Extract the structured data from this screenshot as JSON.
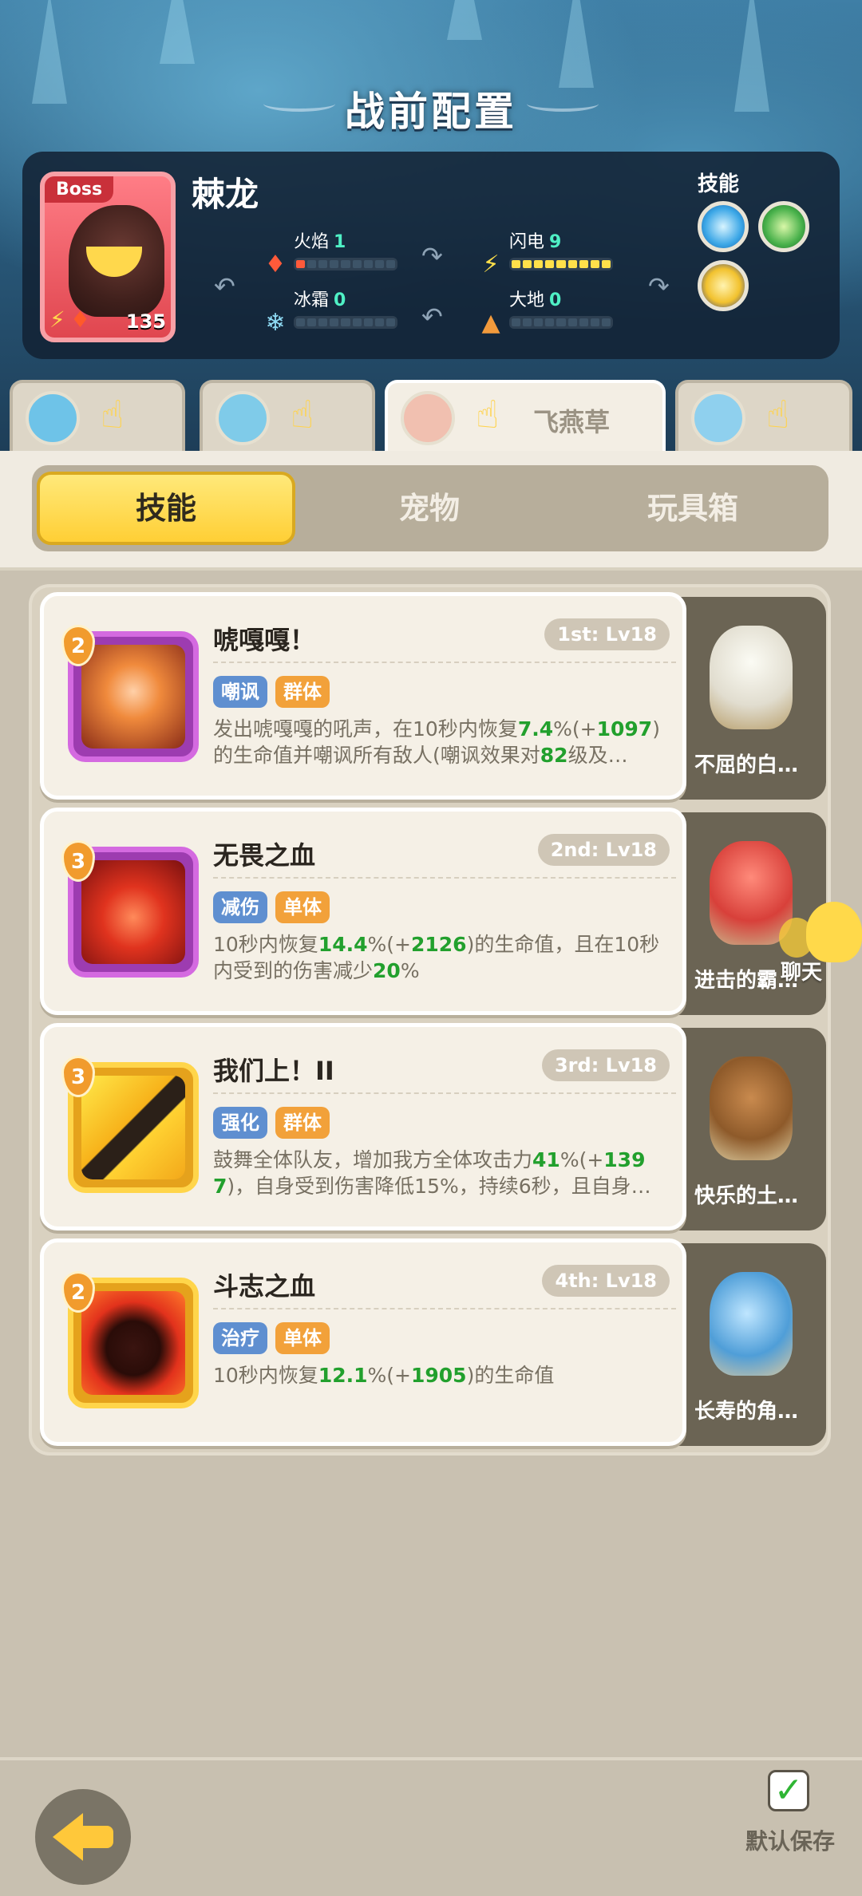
{
  "header": {
    "title": "战前配置"
  },
  "boss": {
    "tag": "Boss",
    "name": "棘龙",
    "level": "135",
    "stats": [
      {
        "label": "火焰",
        "value": "1",
        "icon": "fire-icon",
        "filled": 1,
        "total": 9
      },
      {
        "label": "闪电",
        "value": "9",
        "icon": "lightning-icon",
        "filled": 9,
        "total": 9
      },
      {
        "label": "冰霜",
        "value": "0",
        "icon": "snowflake-icon",
        "filled": 0,
        "total": 9
      },
      {
        "label": "大地",
        "value": "0",
        "icon": "earth-icon",
        "filled": 0,
        "total": 9
      }
    ],
    "skills_label": "技能",
    "skill_orbs": [
      "ice-burst-icon",
      "green-scroll-icon",
      "yellow-moon-icon"
    ]
  },
  "team_tabs": [
    {
      "name": "",
      "avatar_color": "#6ec3e8",
      "active": false
    },
    {
      "name": "",
      "avatar_color": "#7fcbe9",
      "active": false
    },
    {
      "name": "飞燕草",
      "avatar_color": "#f1c0b0",
      "active": true
    },
    {
      "name": "",
      "avatar_color": "#8fd0ee",
      "active": false
    }
  ],
  "categories": [
    {
      "label": "技能",
      "active": true
    },
    {
      "label": "宠物",
      "active": false
    },
    {
      "label": "玩具箱",
      "active": false
    }
  ],
  "skills": [
    {
      "rank": "2",
      "title": "唬嘎嘎！",
      "level": "1st: Lv18",
      "tags": [
        "嘲讽",
        "群体"
      ],
      "frame": "purple",
      "desc_parts": [
        {
          "t": "发出唬嘎嘎的吼声，在10秒内恢复",
          "hl": false
        },
        {
          "t": "7.4",
          "hl": true
        },
        {
          "t": "%(+",
          "hl": false
        },
        {
          "t": "1097",
          "hl": true
        },
        {
          "t": ")的生命值并嘲讽所有敌人(嘲讽效果对",
          "hl": false
        },
        {
          "t": "82",
          "hl": true
        },
        {
          "t": "级及…",
          "hl": false
        }
      ],
      "pet": "不屈的白…"
    },
    {
      "rank": "3",
      "title": "无畏之血",
      "level": "2nd: Lv18",
      "tags": [
        "减伤",
        "单体"
      ],
      "frame": "purple",
      "desc_parts": [
        {
          "t": "10秒内恢复",
          "hl": false
        },
        {
          "t": "14.4",
          "hl": true
        },
        {
          "t": "%(+",
          "hl": false
        },
        {
          "t": "2126",
          "hl": true
        },
        {
          "t": ")的生命值，且在10秒内受到的伤害减少",
          "hl": false
        },
        {
          "t": "20",
          "hl": true
        },
        {
          "t": "%",
          "hl": false
        }
      ],
      "pet": "进击的霸…"
    },
    {
      "rank": "3",
      "title": "我们上！II",
      "level": "3rd: Lv18",
      "tags": [
        "强化",
        "群体"
      ],
      "frame": "gold",
      "desc_parts": [
        {
          "t": "鼓舞全体队友，增加我方全体攻击力",
          "hl": false
        },
        {
          "t": "41",
          "hl": true
        },
        {
          "t": "%(+",
          "hl": false
        },
        {
          "t": "1397",
          "hl": true
        },
        {
          "t": ")，自身受到伤害降低15%，持续6秒，且自身…",
          "hl": false
        }
      ],
      "pet": "快乐的土…"
    },
    {
      "rank": "2",
      "title": "斗志之血",
      "level": "4th: Lv18",
      "tags": [
        "治疗",
        "单体"
      ],
      "frame": "gold",
      "desc_parts": [
        {
          "t": "10秒内恢复",
          "hl": false
        },
        {
          "t": "12.1",
          "hl": true
        },
        {
          "t": "%(+",
          "hl": false
        },
        {
          "t": "1905",
          "hl": true
        },
        {
          "t": ")的生命值",
          "hl": false
        }
      ],
      "pet": "长寿的角…"
    }
  ],
  "chat": {
    "label": "聊天"
  },
  "footer": {
    "save_label": "默认保存"
  }
}
